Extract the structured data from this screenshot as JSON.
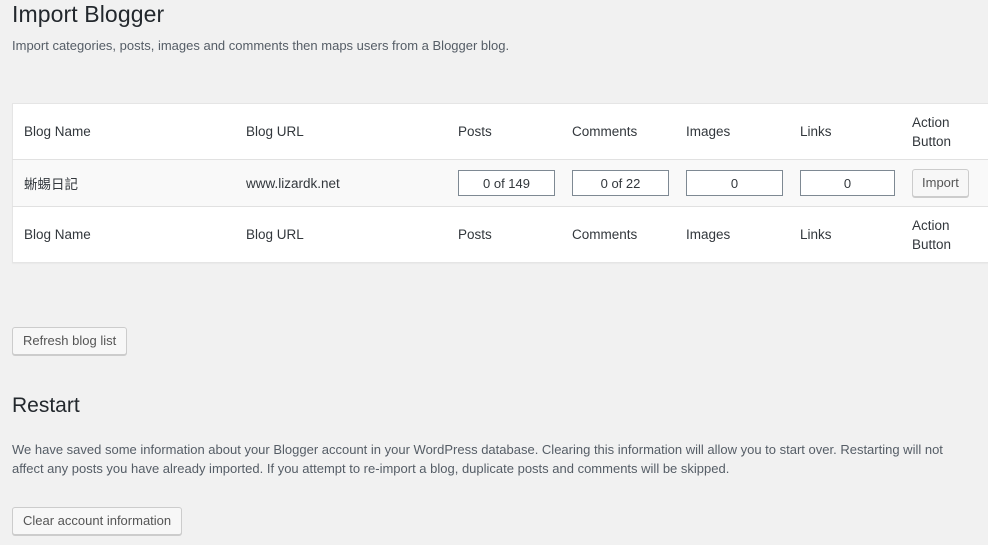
{
  "page": {
    "title": "Import Blogger",
    "description": "Import categories, posts, images and comments then maps users from a Blogger blog."
  },
  "table": {
    "headers": {
      "blog_name": "Blog Name",
      "blog_url": "Blog URL",
      "posts": "Posts",
      "comments": "Comments",
      "images": "Images",
      "links": "Links",
      "action_button": "Action Button"
    },
    "footers": {
      "blog_name": "Blog Name",
      "blog_url": "Blog URL",
      "posts": "Posts",
      "comments": "Comments",
      "images": "Images",
      "links": "Links",
      "action_button": "Action Button"
    },
    "rows": [
      {
        "blog_name": "蜥蜴日記",
        "blog_url": "www.lizardk.net",
        "posts": "0 of 149",
        "comments": "0 of 22",
        "images": "0",
        "links": "0",
        "action_label": "Import"
      }
    ]
  },
  "refresh_button": {
    "label": "Refresh blog list"
  },
  "restart": {
    "title": "Restart",
    "description": "We have saved some information about your Blogger account in your WordPress database. Clearing this information will allow you to start over. Restarting will not affect any posts you have already imported. If you attempt to re-import a blog, duplicate posts and comments will be skipped.",
    "clear_button_label": "Clear account information"
  },
  "colors": {
    "page_background": "#f1f1f1",
    "table_background": "#ffffff",
    "row_background": "#f9f9f9",
    "heading_text": "#23282d",
    "body_text": "#555d66",
    "border": "#e5e5e5",
    "input_border": "#7e8993",
    "button_background": "#f7f7f7",
    "button_border": "#cccccc"
  }
}
